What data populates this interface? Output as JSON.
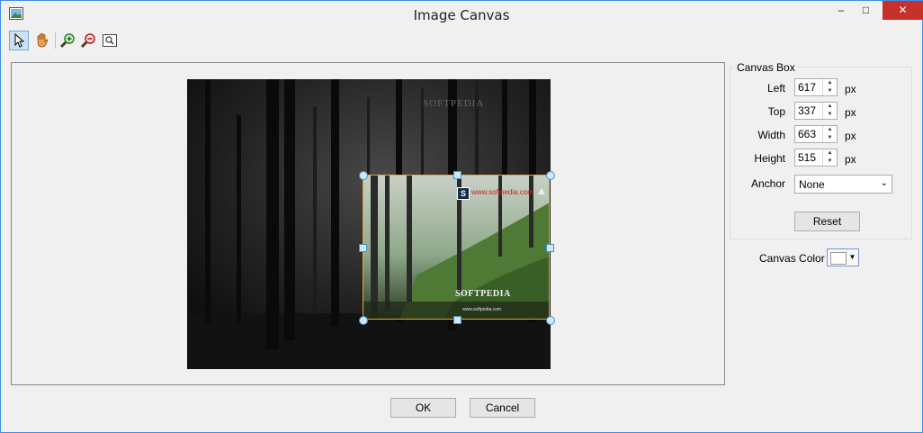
{
  "window": {
    "title": "Image Canvas",
    "min_glyph": "–",
    "max_glyph": "□",
    "close_glyph": "✕"
  },
  "toolbar": {
    "tools": [
      "pointer-icon",
      "hand-icon",
      "zoom-in-icon",
      "zoom-out-icon",
      "zoom-fit-icon"
    ],
    "active": "pointer-icon"
  },
  "canvas": {
    "background_watermark": "SOFTPEDIA",
    "selection_site": "www.softpedia.com",
    "selection_logo": "SOFTPEDIA",
    "selection_url": "www.softpedia.com",
    "logo_letter": "S"
  },
  "canvas_box": {
    "title": "Canvas Box",
    "left_label": "Left",
    "left_value": "617",
    "top_label": "Top",
    "top_value": "337",
    "width_label": "Width",
    "width_value": "663",
    "height_label": "Height",
    "height_value": "515",
    "unit": "px",
    "anchor_label": "Anchor",
    "anchor_value": "None",
    "reset_label": "Reset"
  },
  "canvas_color": {
    "label": "Canvas Color",
    "value": "#ffffff"
  },
  "footer": {
    "ok_label": "OK",
    "cancel_label": "Cancel"
  },
  "colors": {
    "accent": "#3d8ee5",
    "close": "#c7312b",
    "selection_border": "#e8a53a",
    "handle": "#4a90c8"
  }
}
